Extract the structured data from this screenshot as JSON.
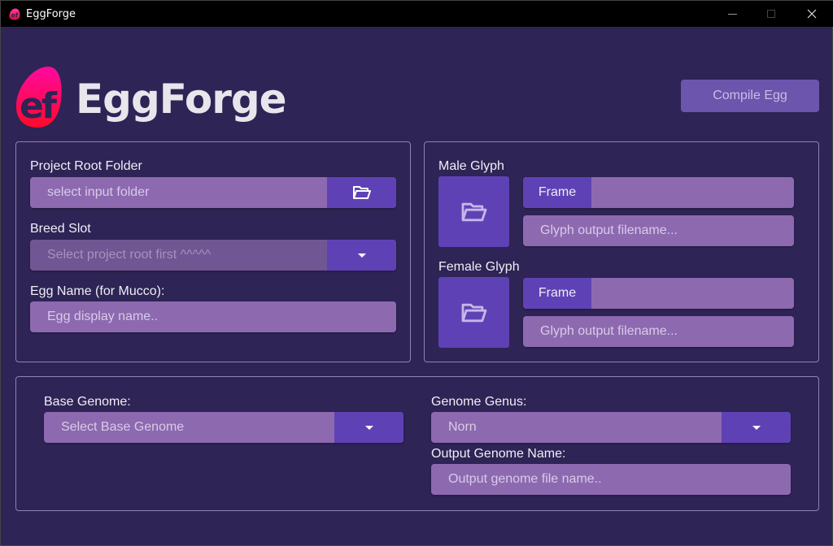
{
  "window": {
    "title": "EggForge",
    "controls": [
      "minimize",
      "maximize",
      "close"
    ]
  },
  "header": {
    "logo_mark": "ef",
    "logo_text": "EggForge",
    "compile_button": "Compile Egg"
  },
  "colors": {
    "background": "#2e2455",
    "field": "#8d69b0",
    "field_disabled": "#705692",
    "accent": "#5e42b5",
    "compile_button": "#6b55ad",
    "logo_gradient_top": "#ff0a9a",
    "logo_gradient_bottom": "#ff0a2e"
  },
  "project_panel": {
    "project_root": {
      "label": "Project Root Folder",
      "placeholder": "select input folder",
      "icon": "folder-open-icon"
    },
    "breed_slot": {
      "label": "Breed Slot",
      "value": "Select project root first ^^^^^",
      "icon": "caret-down-icon",
      "disabled": true
    },
    "egg_name": {
      "label": "Egg Name (for Mucco):",
      "placeholder": "Egg display name.."
    }
  },
  "glyph_panel": {
    "male": {
      "label": "Male Glyph",
      "frame_label": "Frame",
      "frame_value": "",
      "output_placeholder": "Glyph output filename..."
    },
    "female": {
      "label": "Female Glyph",
      "frame_label": "Frame",
      "frame_value": "",
      "output_placeholder": "Glyph output filename..."
    }
  },
  "genome_panel": {
    "base_genome": {
      "label": "Base Genome:",
      "value": "Select Base Genome"
    },
    "genus": {
      "label": "Genome Genus:",
      "value": "Norn"
    },
    "output_name": {
      "label": "Output Genome Name:",
      "placeholder": "Output genome file name.."
    }
  }
}
